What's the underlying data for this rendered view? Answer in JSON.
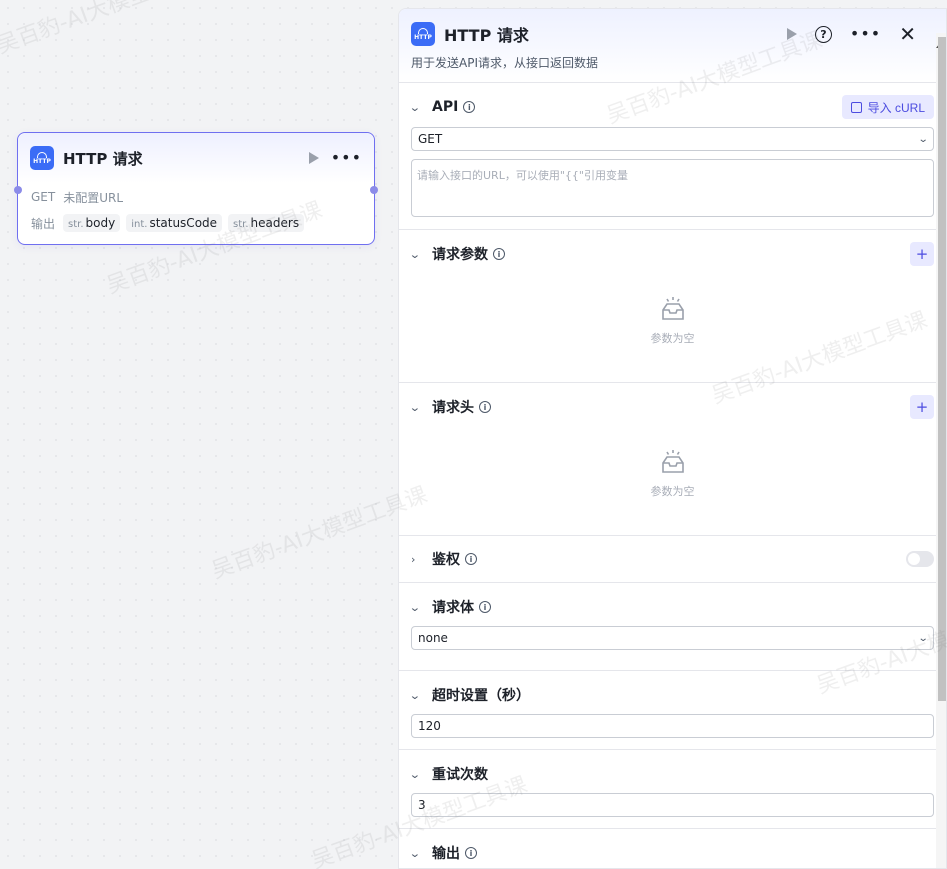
{
  "node": {
    "title": "HTTP 请求",
    "icon_text": "HTTP",
    "method": "GET",
    "url_status": "未配置URL",
    "output_label": "输出",
    "outputs": [
      {
        "type": "str.",
        "name": "body"
      },
      {
        "type": "int.",
        "name": "statusCode"
      },
      {
        "type": "str.",
        "name": "headers"
      }
    ]
  },
  "panel": {
    "title": "HTTP 请求",
    "icon_text": "HTTP",
    "description": "用于发送API请求，从接口返回数据",
    "api": {
      "label": "API",
      "import_label": "导入 cURL",
      "method": "GET",
      "url_placeholder": "请输入接口的URL，可以使用\"{{\"引用变量"
    },
    "params": {
      "label": "请求参数",
      "empty": "参数为空"
    },
    "headers": {
      "label": "请求头",
      "empty": "参数为空"
    },
    "auth": {
      "label": "鉴权",
      "enabled": false
    },
    "body": {
      "label": "请求体",
      "value": "none"
    },
    "timeout": {
      "label": "超时设置（秒）",
      "value": "120"
    },
    "retry": {
      "label": "重试次数",
      "value": "3"
    },
    "output": {
      "label": "输出"
    }
  },
  "watermark": "吴百豹-AI大模型工具课",
  "colors": {
    "accent": "#4c4ce0",
    "node_border": "#6f6ff0",
    "http_icon": "#3b6cf6"
  }
}
